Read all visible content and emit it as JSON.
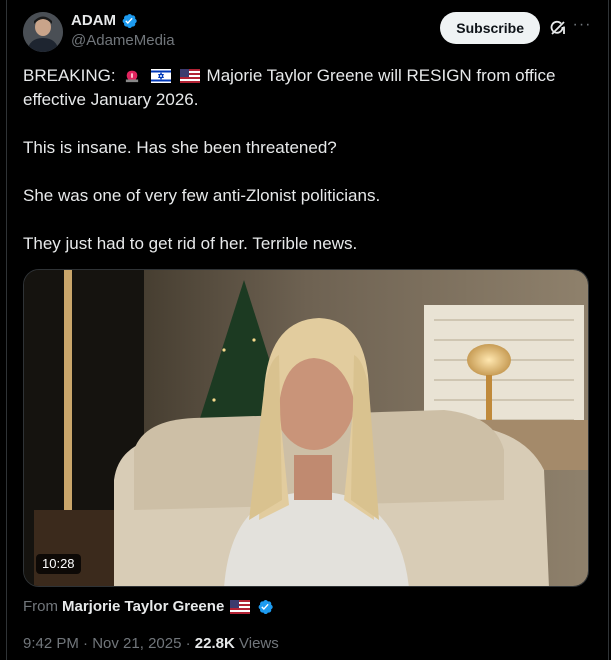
{
  "author": {
    "display_name": "ADAM",
    "handle": "@AdameMedia",
    "verified": true
  },
  "actions": {
    "subscribe_label": "Subscribe",
    "grok_icon": "grok-icon",
    "more_icon": "more-icon"
  },
  "post": {
    "lines": [
      "BREAKING:",
      "Majorie Taylor Greene will RESIGN from office effective January 2026.",
      "This is insane. Has she been threatened?",
      "She was one of very few anti-Zlonist politicians.",
      "They just had to get rid of her. Terrible news."
    ],
    "emojis": [
      "rotating-light-icon",
      "israel-flag-icon",
      "us-flag-icon"
    ]
  },
  "media": {
    "duration": "10:28"
  },
  "source": {
    "prefix": "From",
    "name": "Marjorie Taylor Greene"
  },
  "meta": {
    "time": "9:42 PM",
    "sep1": "·",
    "date": "Nov 21, 2025",
    "sep2": "·",
    "views_count": "22.8K",
    "views_label": "Views"
  },
  "colors": {
    "background": "#000000",
    "text": "#e7e9ea",
    "muted": "#71767b",
    "verified_blue": "#1d9bf0"
  }
}
